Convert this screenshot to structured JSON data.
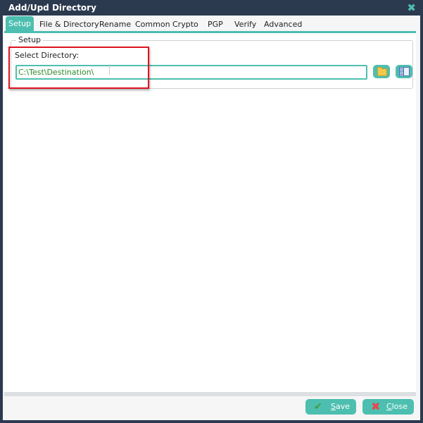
{
  "window": {
    "title": "Add/Upd Directory",
    "close_icon": "close-icon"
  },
  "tabs": [
    {
      "label": "Setup",
      "active": true
    },
    {
      "label": "File & Directory"
    },
    {
      "label": "Rename"
    },
    {
      "label": "Common"
    },
    {
      "label": "Crypto"
    },
    {
      "label": "PGP"
    },
    {
      "label": "Verify"
    },
    {
      "label": "Advanced"
    }
  ],
  "setup": {
    "group_label": "Setup",
    "select_label": "Select Directory:",
    "directory_value": "C:\\Test\\Destination\\",
    "folder_button_icon": "folder-icon",
    "browse_button_icon": "browse-list-icon"
  },
  "footer": {
    "save": {
      "accel": "S",
      "rest": "ave",
      "icon": "checkmark-icon"
    },
    "close": {
      "accel": "C",
      "rest": "lose",
      "icon": "x-icon"
    }
  },
  "colors": {
    "accent": "#4dbfb0",
    "titlebar": "#2b3a4f",
    "highlight": "#e0141e",
    "input_text": "#2a8a2a"
  }
}
